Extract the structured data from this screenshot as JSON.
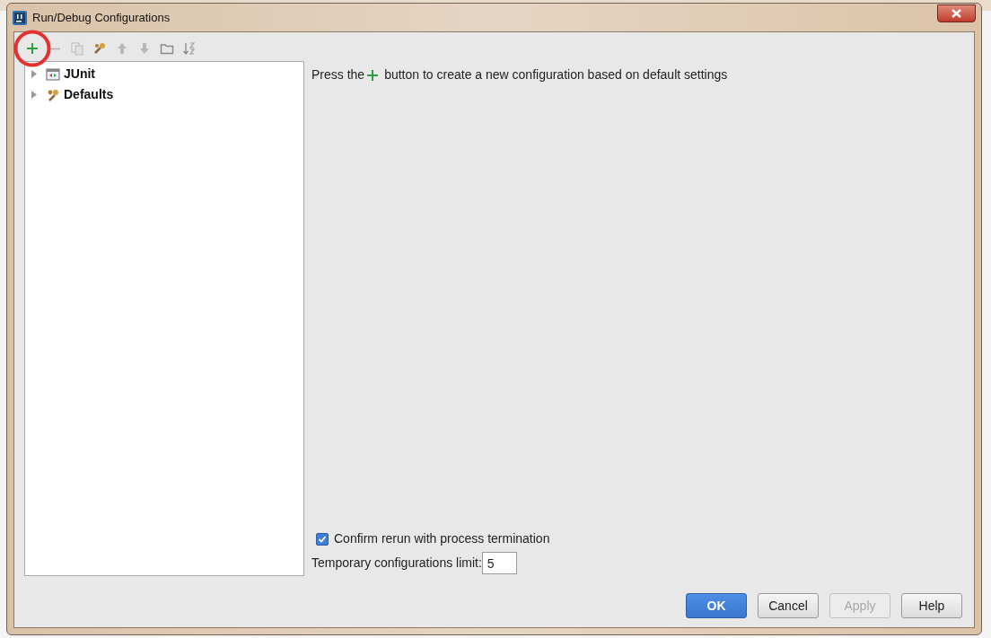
{
  "window": {
    "title": "Run/Debug Configurations"
  },
  "toolbar": [
    {
      "kind": "add",
      "disabled": false,
      "highlighted": true
    },
    {
      "kind": "remove",
      "disabled": true,
      "highlighted": false
    },
    {
      "kind": "copy",
      "disabled": true,
      "highlighted": false
    },
    {
      "kind": "edit-defaults",
      "disabled": false,
      "highlighted": false
    },
    {
      "kind": "up",
      "disabled": true,
      "highlighted": false
    },
    {
      "kind": "down",
      "disabled": true,
      "highlighted": false
    },
    {
      "kind": "folder",
      "disabled": false,
      "highlighted": false
    },
    {
      "kind": "sort",
      "disabled": false,
      "highlighted": false
    }
  ],
  "tree": [
    {
      "label": "JUnit",
      "kind": "junit",
      "expanded": false
    },
    {
      "label": "Defaults",
      "kind": "defaults",
      "expanded": false
    }
  ],
  "message": {
    "before": "Press the",
    "after": "button to create a new configuration based on default settings"
  },
  "confirm_rerun": {
    "label": "Confirm rerun with process termination",
    "checked": true
  },
  "temp_limit": {
    "label": "Temporary configurations limit:",
    "value": "5"
  },
  "buttons": [
    {
      "label": "OK",
      "kind": "default",
      "disabled": false
    },
    {
      "label": "Cancel",
      "kind": "normal",
      "disabled": false
    },
    {
      "label": "Apply",
      "kind": "normal",
      "disabled": true
    },
    {
      "label": "Help",
      "kind": "normal",
      "disabled": false
    }
  ]
}
